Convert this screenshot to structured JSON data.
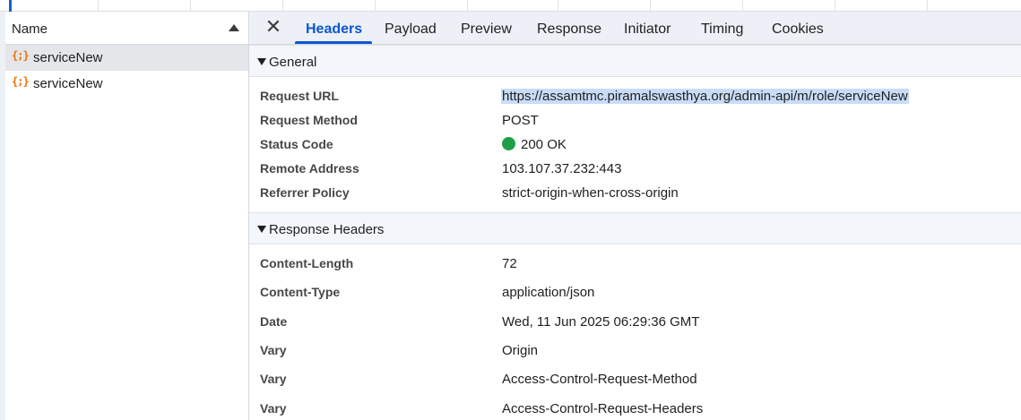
{
  "request_list": {
    "column_header": "Name",
    "items": [
      {
        "icon": "json-fetch-icon",
        "icon_glyph": "{;}",
        "name": "serviceNew"
      },
      {
        "icon": "json-fetch-icon",
        "icon_glyph": "{;}",
        "name": "serviceNew"
      }
    ]
  },
  "details": {
    "close_glyph": "✕",
    "tabs": [
      {
        "label": "Headers",
        "active": true
      },
      {
        "label": "Payload",
        "active": false
      },
      {
        "label": "Preview",
        "active": false
      },
      {
        "label": "Response",
        "active": false
      },
      {
        "label": "Initiator",
        "active": false
      },
      {
        "label": "Timing",
        "active": false
      },
      {
        "label": "Cookies",
        "active": false
      }
    ],
    "general": {
      "title": "General",
      "rows": [
        {
          "key": "Request URL",
          "value": "https://assamtmc.piramalswasthya.org/admin-api/m/role/serviceNew"
        },
        {
          "key": "Request Method",
          "value": "POST"
        },
        {
          "key": "Status Code",
          "value": "200 OK"
        },
        {
          "key": "Remote Address",
          "value": "103.107.37.232:443"
        },
        {
          "key": "Referrer Policy",
          "value": "strict-origin-when-cross-origin"
        }
      ]
    },
    "response_headers": {
      "title": "Response Headers",
      "rows": [
        {
          "key": "Content-Length",
          "value": "72"
        },
        {
          "key": "Content-Type",
          "value": "application/json"
        },
        {
          "key": "Date",
          "value": "Wed, 11 Jun 2025 06:29:36 GMT"
        },
        {
          "key": "Vary",
          "value": "Origin"
        },
        {
          "key": "Vary",
          "value": "Access-Control-Request-Method"
        },
        {
          "key": "Vary",
          "value": "Access-Control-Request-Headers"
        }
      ]
    }
  },
  "colors": {
    "accent": "#0b57d0",
    "status_ok": "#1e9e47",
    "selection": "#c9dcf7",
    "json_icon": "#e8710a"
  }
}
